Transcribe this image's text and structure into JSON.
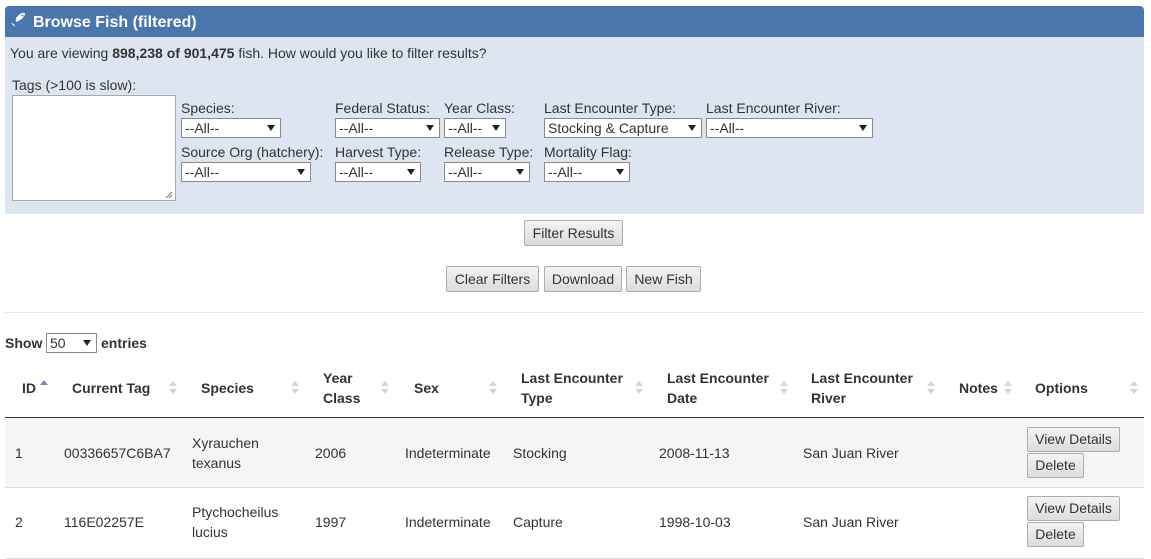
{
  "panel": {
    "title": "Browse Fish (filtered)",
    "summary_prefix": "You are viewing ",
    "summary_count": "898,238 of 901,475",
    "summary_suffix": " fish. How would you like to filter results?"
  },
  "filters": {
    "tags_label": "Tags (>100 is slow):",
    "species": {
      "label": "Species:",
      "value": "--All--"
    },
    "federal_status": {
      "label": "Federal Status:",
      "value": "--All--"
    },
    "year_class": {
      "label": "Year Class:",
      "value": "--All--"
    },
    "last_encounter_type": {
      "label": "Last Encounter Type:",
      "value": "Stocking & Capture"
    },
    "last_encounter_river": {
      "label": "Last Encounter River:",
      "value": "--All--"
    },
    "source_org": {
      "label": "Source Org (hatchery):",
      "value": "--All--"
    },
    "harvest_type": {
      "label": "Harvest Type:",
      "value": "--All--"
    },
    "release_type": {
      "label": "Release Type:",
      "value": "--All--"
    },
    "mortality_flag": {
      "label": "Mortality Flag:",
      "value": "--All--"
    }
  },
  "buttons": {
    "filter_results": "Filter Results",
    "clear_filters": "Clear Filters",
    "download": "Download",
    "new_fish": "New Fish"
  },
  "length": {
    "show": "Show",
    "value": "50",
    "entries": "entries"
  },
  "table": {
    "columns": {
      "id": "ID",
      "current_tag": "Current Tag",
      "species": "Species",
      "year_class_1": "Year",
      "year_class_2": "Class",
      "sex": "Sex",
      "let_1": "Last Encounter",
      "let_2": "Type",
      "led_1": "Last Encounter",
      "led_2": "Date",
      "ler_1": "Last Encounter",
      "ler_2": "River",
      "notes": "Notes",
      "options": "Options"
    },
    "rows": [
      {
        "id": "1",
        "tag": "00336657C6BA7",
        "species_1": "Xyrauchen",
        "species_2": "texanus",
        "year": "2006",
        "sex": "Indeterminate",
        "type": "Stocking",
        "date": "2008-11-13",
        "river": "San Juan River",
        "notes": "",
        "view": "View Details",
        "delete": "Delete"
      },
      {
        "id": "2",
        "tag": "116E02257E",
        "species_1": "Ptychocheilus",
        "species_2": "lucius",
        "year": "1997",
        "sex": "Indeterminate",
        "type": "Capture",
        "date": "1998-10-03",
        "river": "San Juan River",
        "notes": "",
        "view": "View Details",
        "delete": "Delete"
      }
    ]
  },
  "colors": {
    "header": "#4a75ad",
    "panel_body": "#dde6f0",
    "row_odd": "#f5f5f5",
    "sort_active": "#6c8dc5"
  }
}
